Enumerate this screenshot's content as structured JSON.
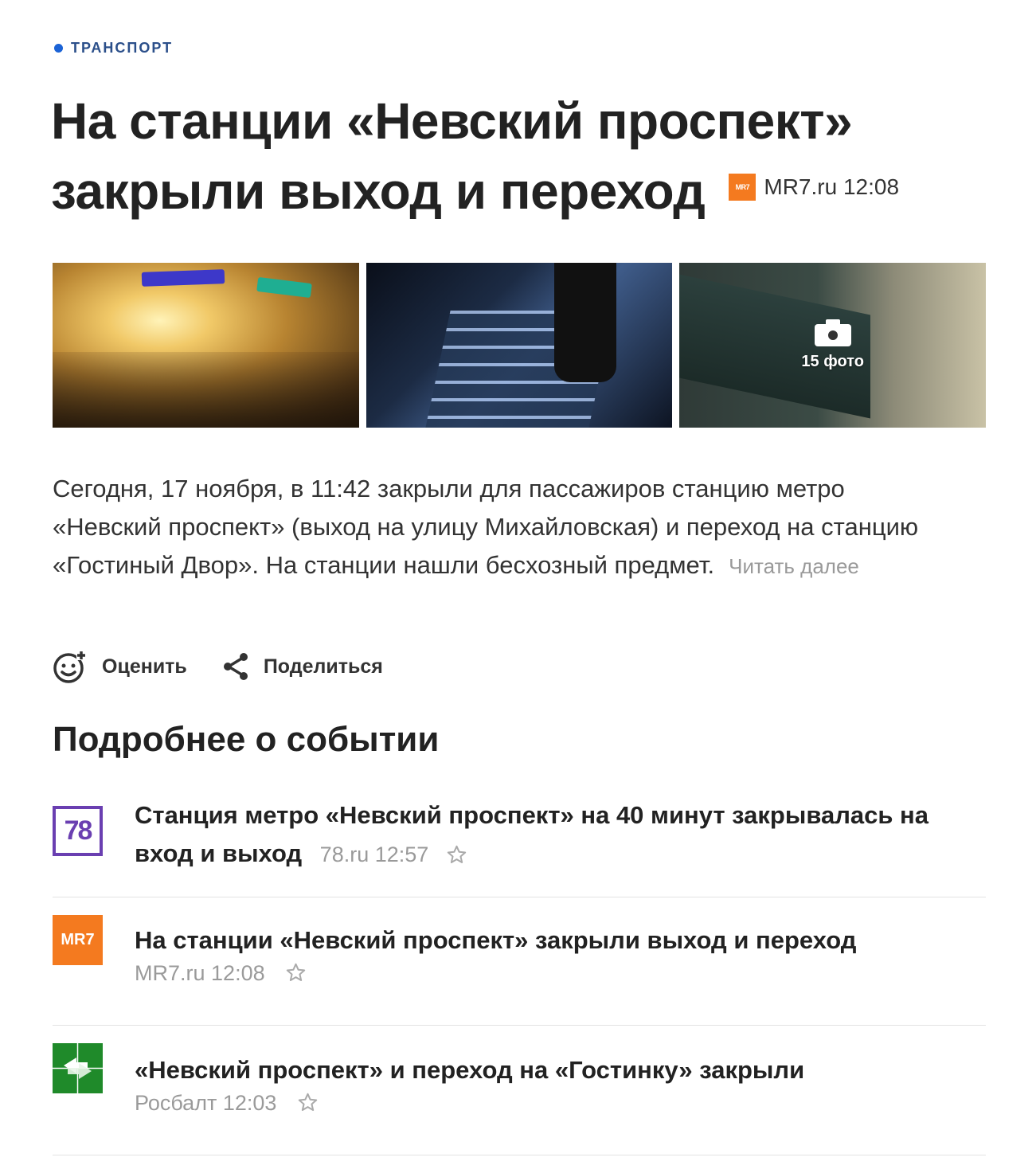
{
  "category": {
    "label": "ТРАНСПОРТ",
    "dot_color": "#1b63d6"
  },
  "article": {
    "title": "На станции «Невский проспект» закрыли выход и переход",
    "source_logo_text": "MR7",
    "source_name": "MR7.ru",
    "time": "12:08",
    "gallery": {
      "photo_icon": "camera-icon",
      "photo_count": "15 фото"
    },
    "summary": "Сегодня, 17 ноября, в 11:42 закрыли для пассажиров станцию метро «Невский проспект» (выход на улицу Михайловская) и переход на станцию «Гостиный Двор». На станции нашли бесхозный предмет.",
    "read_more": "Читать далее"
  },
  "actions": {
    "rate": {
      "label": "Оценить",
      "icon": "smiley-plus-icon"
    },
    "share": {
      "label": "Поделиться",
      "icon": "share-icon"
    }
  },
  "related_section": {
    "title": "Подробнее о событии",
    "items": [
      {
        "logo_text": "78",
        "logo_color": "#6a3fb1",
        "title": "Станция метро «Невский проспект» на 40 минут закрывалась на вход и выход",
        "source": "78.ru",
        "time": "12:57"
      },
      {
        "logo_text": "MR7",
        "logo_color": "#f47a1f",
        "title": "На станции «Невский проспект» закрыли выход и переход",
        "source": "MR7.ru",
        "time": "12:08"
      },
      {
        "logo_icon": "rosbalt-arrows-icon",
        "logo_color": "#1f8a2a",
        "title": "«Невский проспект» и переход на «Гостинку» закрыли",
        "source": "Росбалт",
        "time": "12:03"
      }
    ]
  }
}
